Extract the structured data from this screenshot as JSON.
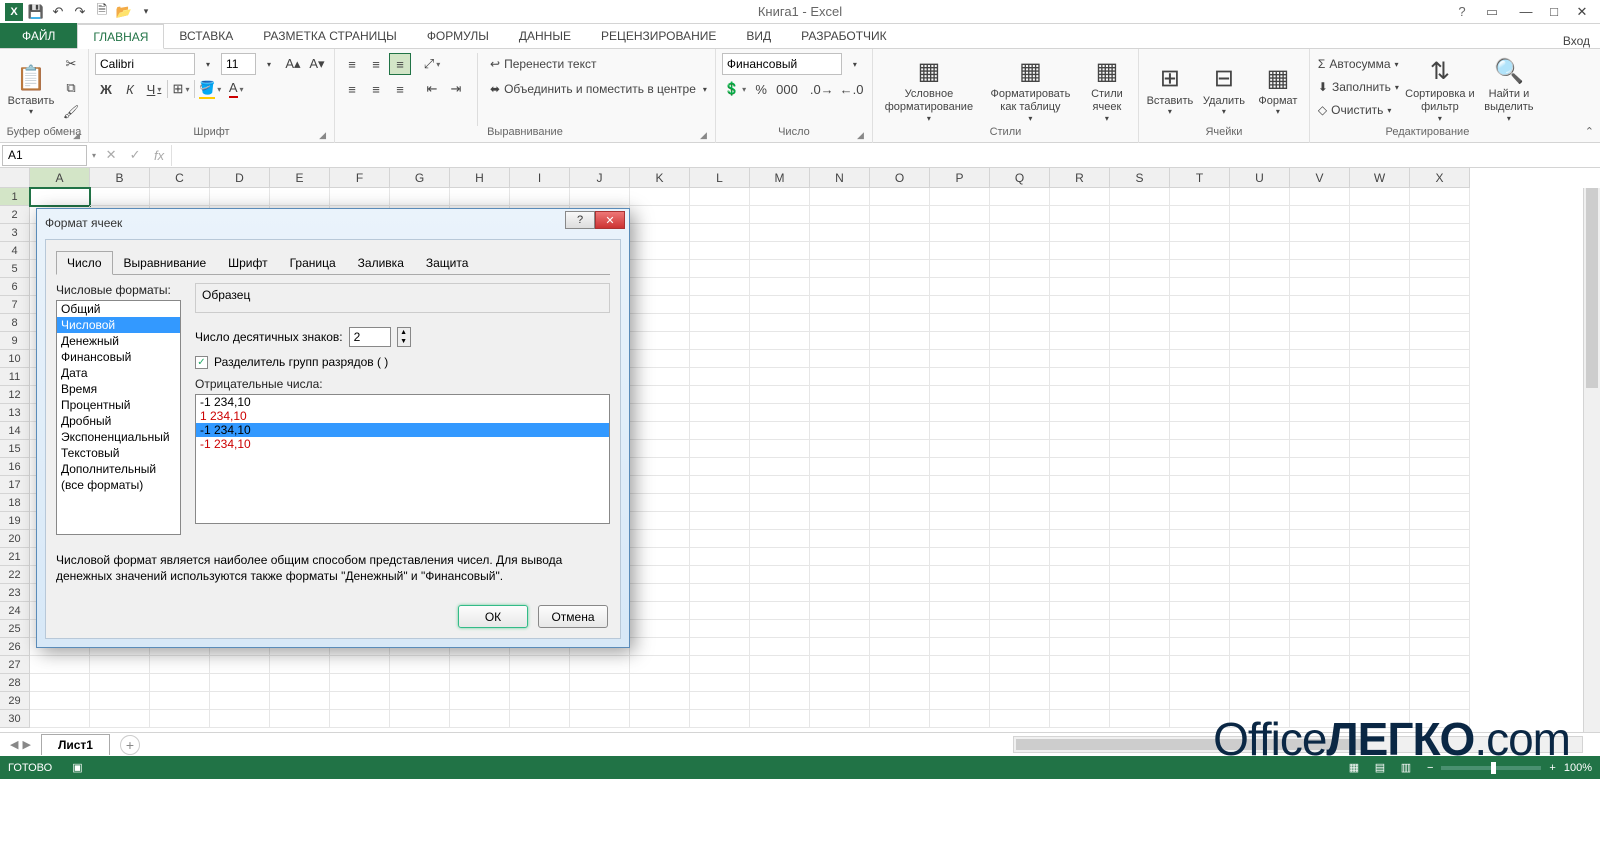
{
  "app": {
    "title": "Книга1 - Excel",
    "login": "Вход"
  },
  "tabs": {
    "file": "ФАЙЛ",
    "home": "ГЛАВНАЯ",
    "insert": "ВСТАВКА",
    "layout": "РАЗМЕТКА СТРАНИЦЫ",
    "formulas": "ФОРМУЛЫ",
    "data": "ДАННЫЕ",
    "review": "РЕЦЕНЗИРОВАНИЕ",
    "view": "ВИД",
    "developer": "РАЗРАБОТЧИК"
  },
  "ribbon": {
    "clipboard": {
      "paste": "Вставить",
      "label": "Буфер обмена"
    },
    "font": {
      "name": "Calibri",
      "size": "11",
      "bold": "Ж",
      "italic": "К",
      "underline": "Ч",
      "label": "Шрифт"
    },
    "align": {
      "wrap": "Перенести текст",
      "merge": "Объединить и поместить в центре",
      "label": "Выравнивание"
    },
    "number": {
      "format": "Финансовый",
      "label": "Число"
    },
    "styles": {
      "cond": "Условное форматирование",
      "table": "Форматировать как таблицу",
      "cell": "Стили ячеек",
      "label": "Стили"
    },
    "cells": {
      "insert": "Вставить",
      "delete": "Удалить",
      "format": "Формат",
      "label": "Ячейки"
    },
    "editing": {
      "sum": "Автосумма",
      "fill": "Заполнить",
      "clear": "Очистить",
      "sort": "Сортировка и фильтр",
      "find": "Найти и выделить",
      "label": "Редактирование"
    }
  },
  "namebox": "A1",
  "columns": [
    "A",
    "B",
    "C",
    "D",
    "E",
    "F",
    "G",
    "H",
    "I",
    "J",
    "K",
    "L",
    "M",
    "N",
    "O",
    "P",
    "Q",
    "R",
    "S",
    "T",
    "U",
    "V",
    "W",
    "X"
  ],
  "rows": [
    "1",
    "2",
    "3",
    "4",
    "5",
    "6",
    "7",
    "8",
    "9",
    "10",
    "11",
    "12",
    "13",
    "14",
    "15",
    "16",
    "17",
    "18",
    "19",
    "20",
    "21",
    "22",
    "23",
    "24",
    "25",
    "26",
    "27",
    "28",
    "29",
    "30"
  ],
  "sheet": {
    "name": "Лист1"
  },
  "status": {
    "ready": "ГОТОВО",
    "zoom": "100%"
  },
  "dialog": {
    "title": "Формат ячеек",
    "tabs": {
      "number": "Число",
      "align": "Выравнивание",
      "font": "Шрифт",
      "border": "Граница",
      "fill": "Заливка",
      "protect": "Защита"
    },
    "catlabel": "Числовые форматы:",
    "cats": [
      "Общий",
      "Числовой",
      "Денежный",
      "Финансовый",
      "Дата",
      "Время",
      "Процентный",
      "Дробный",
      "Экспоненциальный",
      "Текстовый",
      "Дополнительный",
      "(все форматы)"
    ],
    "sample": "Образец",
    "decimals_label": "Число десятичных знаков:",
    "decimals": "2",
    "sep": "Разделитель групп разрядов ( )",
    "neg_label": "Отрицательные числа:",
    "neg": [
      "-1 234,10",
      "1 234,10",
      "-1 234,10",
      "-1 234,10"
    ],
    "desc": "Числовой формат является наиболее общим способом представления чисел. Для вывода денежных значений используются также форматы \"Денежный\" и \"Финансовый\".",
    "ok": "ОК",
    "cancel": "Отмена"
  },
  "watermark": {
    "p1": "Office",
    "p2": "ЛЕГКО",
    "p3": ".com"
  }
}
